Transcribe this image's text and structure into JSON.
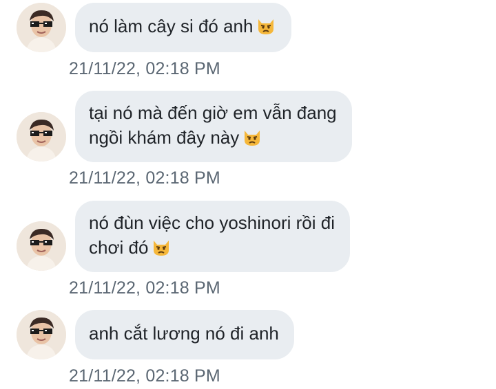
{
  "messages": [
    {
      "lines": [
        "nó làm cây si đó anh"
      ],
      "emoji": "pouting-cat-icon",
      "timestamp": "21/11/22, 02:18 PM"
    },
    {
      "lines": [
        "tại nó mà đến giờ em vẫn đang",
        "ngồi khám đây này"
      ],
      "emoji": "pouting-cat-icon",
      "timestamp": "21/11/22, 02:18 PM"
    },
    {
      "lines": [
        "nó đùn việc cho yoshinori rồi đi",
        "chơi đó"
      ],
      "emoji": "pouting-cat-icon",
      "timestamp": "21/11/22, 02:18 PM"
    },
    {
      "lines": [
        "anh cắt lương nó đi anh"
      ],
      "emoji": "",
      "timestamp": "21/11/22, 02:18 PM"
    }
  ],
  "colors": {
    "bubble": "#e9edf1",
    "text": "#1f2328",
    "timestamp": "#5b6773"
  }
}
